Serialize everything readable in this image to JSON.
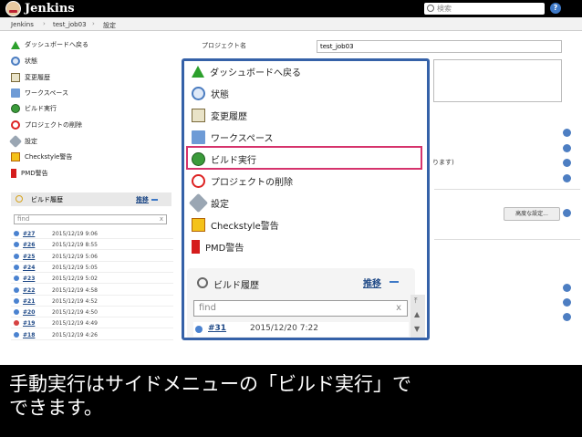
{
  "header": {
    "app_name": "Jenkins",
    "search_placeholder": "検索",
    "help_icon": "?"
  },
  "breadcrumb": [
    "Jenkins",
    "test_job03",
    "設定"
  ],
  "breadcrumb_sep": "›",
  "sidebar": {
    "items": [
      {
        "label": "ダッシュボードへ戻る",
        "icon": "up-arrow-icon"
      },
      {
        "label": "状態",
        "icon": "magnifier-icon"
      },
      {
        "label": "変更履歴",
        "icon": "notepad-icon"
      },
      {
        "label": "ワークスペース",
        "icon": "folder-icon"
      },
      {
        "label": "ビルド実行",
        "icon": "build-icon"
      },
      {
        "label": "プロジェクトの削除",
        "icon": "no-entry-icon"
      },
      {
        "label": "設定",
        "icon": "tools-icon"
      },
      {
        "label": "Checkstyle警告",
        "icon": "checkstyle-icon"
      },
      {
        "label": "PMD警告",
        "icon": "pmd-icon"
      }
    ]
  },
  "build_history": {
    "title": "ビルド履歴",
    "trend_label": "推移",
    "filter_placeholder": "find",
    "clear": "x",
    "builds": [
      {
        "num": "#27",
        "date": "2015/12/19 9:06",
        "status": "blue"
      },
      {
        "num": "#26",
        "date": "2015/12/19 8:55",
        "status": "blue"
      },
      {
        "num": "#25",
        "date": "2015/12/19 5:06",
        "status": "blue"
      },
      {
        "num": "#24",
        "date": "2015/12/19 5:05",
        "status": "blue"
      },
      {
        "num": "#23",
        "date": "2015/12/19 5:02",
        "status": "blue"
      },
      {
        "num": "#22",
        "date": "2015/12/19 4:58",
        "status": "blue"
      },
      {
        "num": "#21",
        "date": "2015/12/19 4:52",
        "status": "blue"
      },
      {
        "num": "#20",
        "date": "2015/12/19 4:50",
        "status": "blue"
      },
      {
        "num": "#19",
        "date": "2015/12/19 4:49",
        "status": "red"
      },
      {
        "num": "#18",
        "date": "2015/12/19 4:26",
        "status": "blue"
      }
    ]
  },
  "form": {
    "project_name_label": "プロジェクト名",
    "project_name_value": "test_job03",
    "masu_fragment": "ります)",
    "advanced_button": "高度な設定..."
  },
  "callout": {
    "items": [
      {
        "label": "ダッシュボードへ戻る",
        "icon": "up-arrow-icon"
      },
      {
        "label": "状態",
        "icon": "magnifier-icon"
      },
      {
        "label": "変更履歴",
        "icon": "notepad-icon"
      },
      {
        "label": "ワークスペース",
        "icon": "folder-icon"
      },
      {
        "label": "ビルド実行",
        "icon": "build-icon"
      },
      {
        "label": "プロジェクトの削除",
        "icon": "no-entry-icon"
      },
      {
        "label": "設定",
        "icon": "tools-icon"
      },
      {
        "label": "Checkstyle警告",
        "icon": "checkstyle-icon"
      },
      {
        "label": "PMD警告",
        "icon": "pmd-icon"
      }
    ],
    "history_title": "ビルド履歴",
    "trend_label": "推移",
    "filter_placeholder": "find",
    "clear": "x",
    "latest_build": {
      "num": "#31",
      "date": "2015/12/20 7:22"
    },
    "highlight_color": "#d6336c",
    "border_color": "#3561a8"
  },
  "caption": {
    "line1": "手動実行はサイドメニューの「ビルド実行」で",
    "line2": "できます。"
  }
}
